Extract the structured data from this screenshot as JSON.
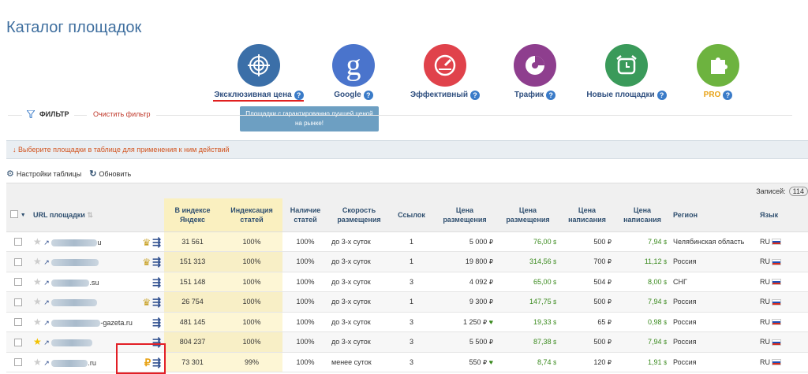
{
  "page": {
    "title": "Каталог площадок"
  },
  "categories": [
    {
      "label": "Эксклюзивная цена",
      "icon": "target-icon",
      "color": "#3b6fa8",
      "active": true
    },
    {
      "label": "Google",
      "icon": "google-g-icon",
      "color": "#4a74cc"
    },
    {
      "label": "Эффективный",
      "icon": "speedometer-icon",
      "color": "#e0424b"
    },
    {
      "label": "Трафик",
      "icon": "pie-chart-icon",
      "color": "#8e3e8e"
    },
    {
      "label": "Новые площадки",
      "icon": "alarm-clock-icon",
      "color": "#3a9a5a"
    },
    {
      "label": "PRO",
      "icon": "puzzle-icon",
      "color": "#6db33f"
    }
  ],
  "tooltip": "Площадки с гарантированно лучшей ценой на рынке!",
  "filter": {
    "label": "ФИЛЬТР",
    "clear": "Очистить фильтр"
  },
  "notice": "↓ Выберите площадки в таблице для применения к ним действий",
  "tools": {
    "settings": "Настройки таблицы",
    "refresh": "Обновить"
  },
  "records": {
    "label": "Записей:",
    "count": "114"
  },
  "table": {
    "headers": {
      "url": "URL площадки",
      "index": "В индексе Яндекс",
      "indexing": "Индексация статей",
      "availability": "Наличие статей",
      "speed": "Скорость размещения",
      "links": "Ссылок",
      "price_rub": "Цена размещения",
      "price_usd": "Цена размещения",
      "write_rub": "Цена написания",
      "write_usd": "Цена написания",
      "region": "Регион",
      "lang": "Язык"
    },
    "rows": [
      {
        "suffix": "u",
        "fav": false,
        "crown": true,
        "ruble": false,
        "index": "31 561",
        "indexing": "100%",
        "availability": "100%",
        "speed": "до 3-х суток",
        "links": "1",
        "price_rub": "5 000",
        "price_usd": "76,00",
        "write_rub": "500",
        "write_usd": "7,94",
        "region": "Челябинская область",
        "lang": "RU",
        "heart": false
      },
      {
        "suffix": "",
        "fav": false,
        "crown": true,
        "ruble": false,
        "index": "151 313",
        "indexing": "100%",
        "availability": "100%",
        "speed": "до 3-х суток",
        "links": "1",
        "price_rub": "19 800",
        "price_usd": "314,56",
        "write_rub": "700",
        "write_usd": "11,12",
        "region": "Россия",
        "lang": "RU",
        "heart": false
      },
      {
        "suffix": ".su",
        "fav": false,
        "crown": false,
        "ruble": false,
        "index": "151 148",
        "indexing": "100%",
        "availability": "100%",
        "speed": "до 3-х суток",
        "links": "3",
        "price_rub": "4 092",
        "price_usd": "65,00",
        "write_rub": "504",
        "write_usd": "8,00",
        "region": "СНГ",
        "lang": "RU",
        "heart": false
      },
      {
        "suffix": "",
        "fav": false,
        "crown": true,
        "ruble": false,
        "index": "26 754",
        "indexing": "100%",
        "availability": "100%",
        "speed": "до 3-х суток",
        "links": "1",
        "price_rub": "9 300",
        "price_usd": "147,75",
        "write_rub": "500",
        "write_usd": "7,94",
        "region": "Россия",
        "lang": "RU",
        "heart": false
      },
      {
        "suffix": "-gazeta.ru",
        "fav": false,
        "crown": false,
        "ruble": false,
        "index": "481 145",
        "indexing": "100%",
        "availability": "100%",
        "speed": "до 3-х суток",
        "links": "3",
        "price_rub": "1 250",
        "price_usd": "19,33",
        "write_rub": "65",
        "write_usd": "0,98",
        "region": "Россия",
        "lang": "RU",
        "heart": true
      },
      {
        "suffix": "",
        "fav": true,
        "crown": false,
        "ruble": false,
        "index": "804 237",
        "indexing": "100%",
        "availability": "100%",
        "speed": "до 3-х суток",
        "links": "3",
        "price_rub": "5 500",
        "price_usd": "87,38",
        "write_rub": "500",
        "write_usd": "7,94",
        "region": "Россия",
        "lang": "RU",
        "heart": false
      },
      {
        "suffix": ".ru",
        "fav": false,
        "crown": false,
        "ruble": true,
        "index": "73 301",
        "indexing": "99%",
        "availability": "100%",
        "speed": "менее суток",
        "links": "3",
        "price_rub": "550",
        "price_usd": "8,74",
        "write_rub": "120",
        "write_usd": "1,91",
        "region": "Россия",
        "lang": "RU",
        "heart": true
      }
    ]
  }
}
